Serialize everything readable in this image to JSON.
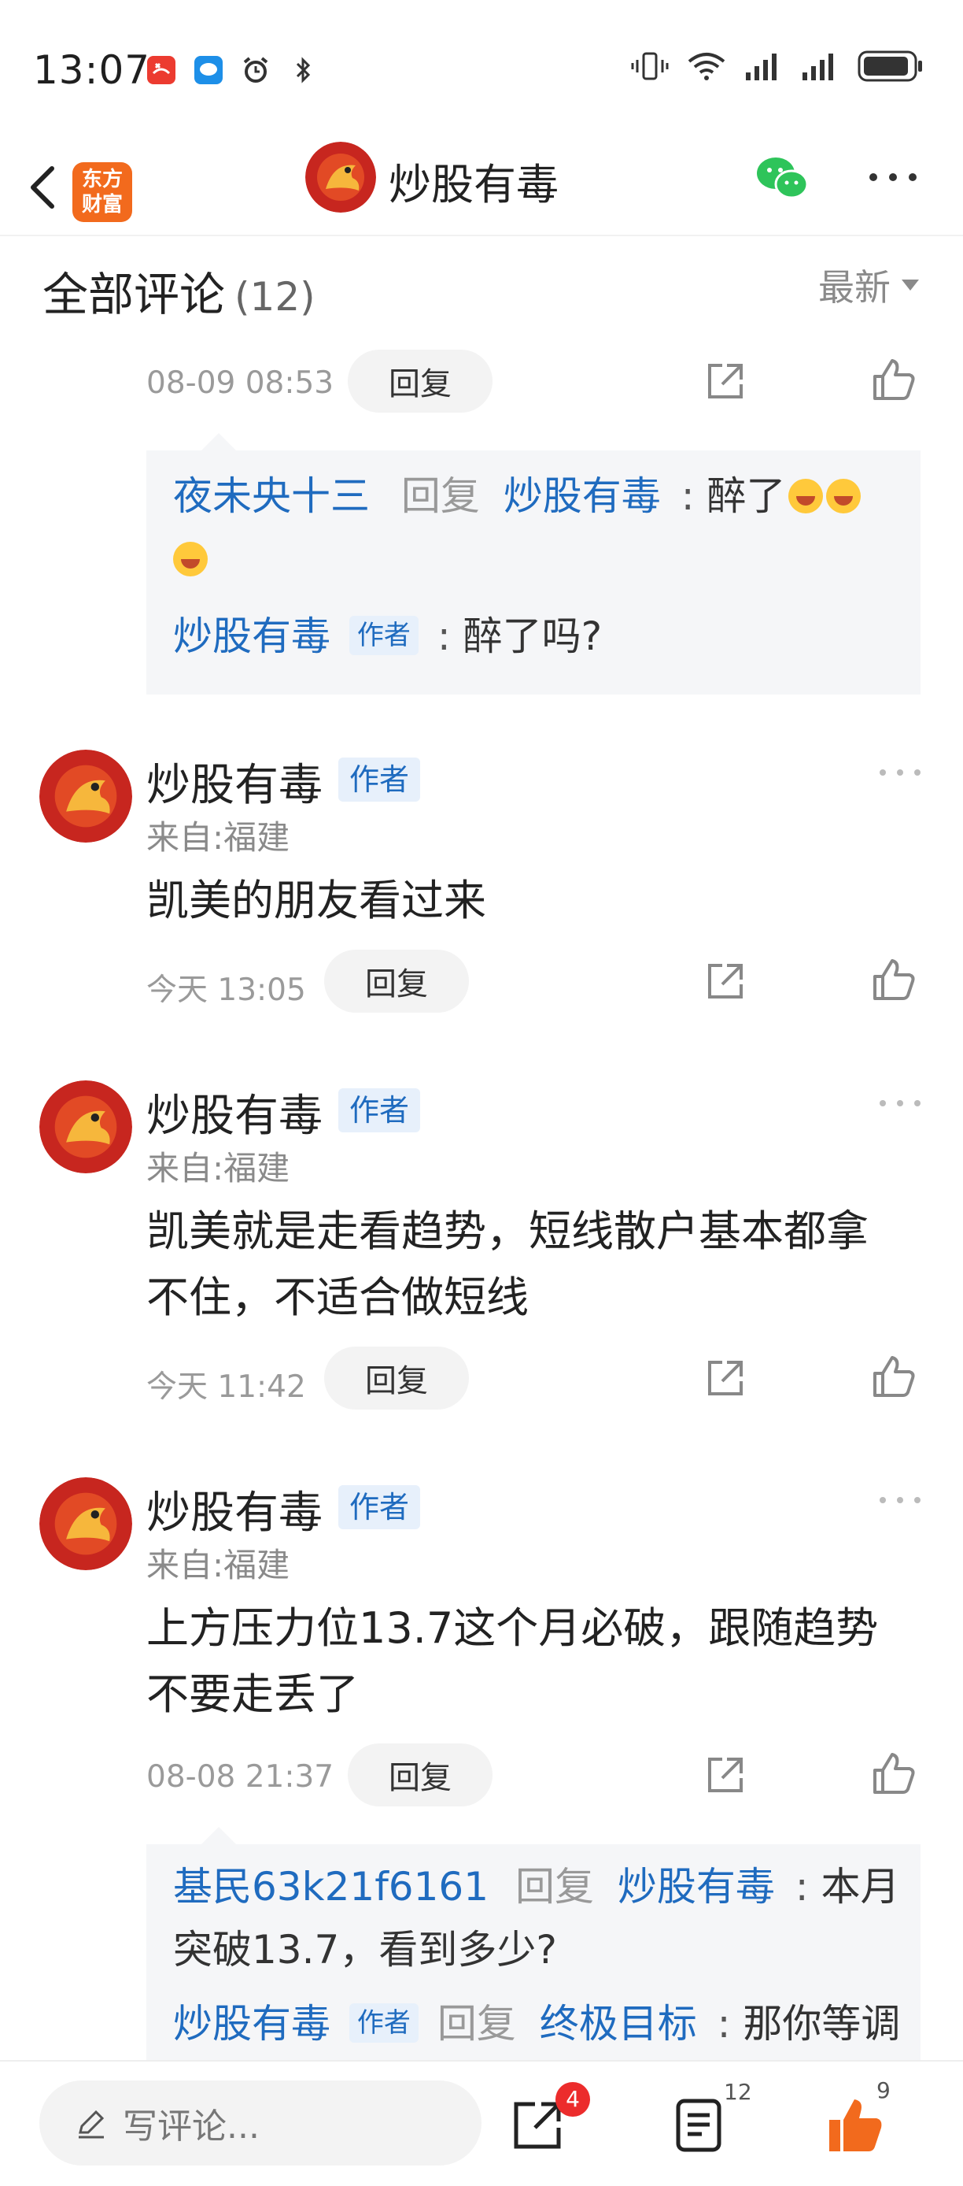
{
  "status_bar": {
    "time": "13:07"
  },
  "header": {
    "app_logo_line1": "东方",
    "app_logo_line2": "财富",
    "title": "炒股有毒"
  },
  "comments_section": {
    "title": "全部评论",
    "count": "(12)",
    "sort_label": "最新"
  },
  "comments": [
    {
      "time": "08-09 08:53",
      "reply_label": "回复",
      "thread": [
        {
          "user": "夜未央十三",
          "reply_word": "回复",
          "target": "炒股有毒",
          "sep": ":",
          "text": "醉了"
        },
        {
          "user": "炒股有毒",
          "author_tag": "作者",
          "sep": ":",
          "text": "醉了吗?"
        }
      ]
    },
    {
      "user": "炒股有毒",
      "author_tag": "作者",
      "from": "来自:福建",
      "text": "凯美的朋友看过来",
      "time": "今天 13:05",
      "reply_label": "回复"
    },
    {
      "user": "炒股有毒",
      "author_tag": "作者",
      "from": "来自:福建",
      "text_line1": "凯美就是走看趋势，短线散户基本都拿",
      "text_line2": "不住，不适合做短线",
      "time": "今天 11:42",
      "reply_label": "回复"
    },
    {
      "user": "炒股有毒",
      "author_tag": "作者",
      "from": "来自:福建",
      "text_line1": "上方压力位13.7这个月必破，跟随趋势",
      "text_line2": "不要走丢了",
      "time": "08-08 21:37",
      "reply_label": "回复",
      "thread": [
        {
          "user": "基民63k21f6161",
          "reply_word": "回复",
          "target": "炒股有毒",
          "sep": ":",
          "text_line1": "本月",
          "text_line2": "突破13.7，看到多少?"
        },
        {
          "user": "炒股有毒",
          "author_tag": "作者",
          "reply_word": "回复",
          "target": "终极目标",
          "sep": ":",
          "text": "那你等调"
        }
      ]
    }
  ],
  "bottom_bar": {
    "write_placeholder": "写评论...",
    "share_badge": "4",
    "comment_count": "12",
    "like_count": "9"
  },
  "colors": {
    "accent_blue": "#1f6bbf",
    "like_orange": "#f26a1d",
    "badge_red": "#ec2c2c"
  }
}
